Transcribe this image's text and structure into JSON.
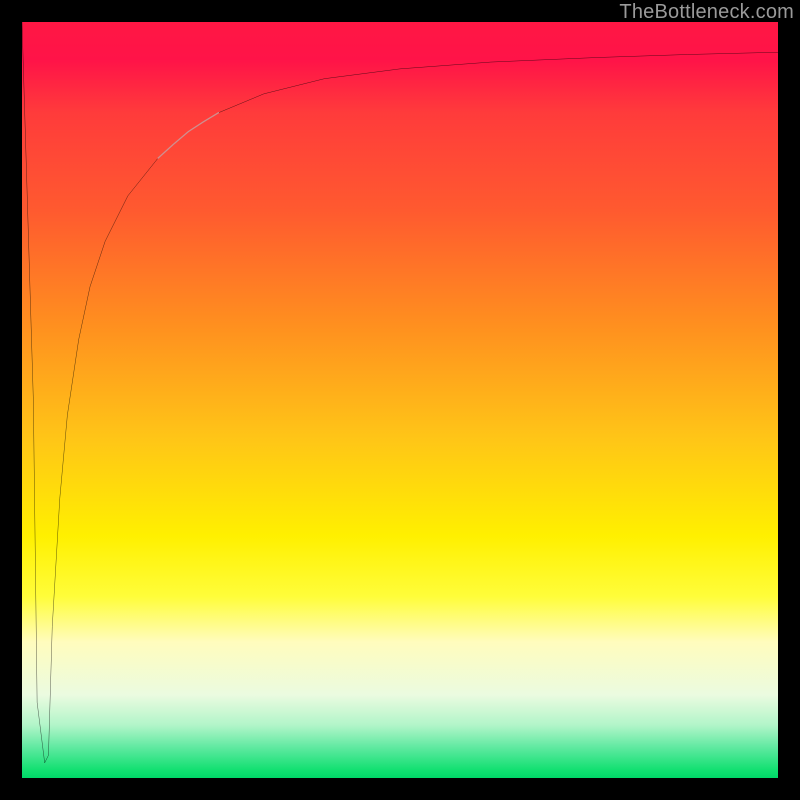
{
  "watermark": "TheBottleneck.com",
  "colors": {
    "frame": "#000000",
    "curve": "#000000",
    "highlight": "#d08f8f",
    "grad_top": "#ff1744",
    "grad_mid": "#fff000",
    "grad_bot": "#00d868"
  },
  "chart_data": {
    "type": "line",
    "title": "",
    "xlabel": "",
    "ylabel": "",
    "xlim": [
      0,
      100
    ],
    "ylim": [
      0,
      100
    ],
    "grid": false,
    "annotations": [
      "watermark top-right: TheBottleneck.com"
    ],
    "series": [
      {
        "name": "curve",
        "x": [
          0,
          1.5,
          2,
          3,
          3.5,
          4,
          5,
          6,
          7.5,
          9,
          11,
          14,
          18,
          22,
          26,
          32,
          40,
          50,
          62,
          76,
          88,
          100
        ],
        "y": [
          100,
          50,
          10,
          2,
          3,
          20,
          37,
          48,
          58,
          65,
          71,
          77,
          82,
          85.5,
          88,
          90.5,
          92.5,
          93.8,
          94.7,
          95.3,
          95.7,
          96
        ]
      },
      {
        "name": "highlight-segment",
        "x": [
          18,
          20,
          22,
          24,
          26
        ],
        "y": [
          82,
          83.8,
          85.5,
          86.8,
          88
        ]
      }
    ]
  }
}
